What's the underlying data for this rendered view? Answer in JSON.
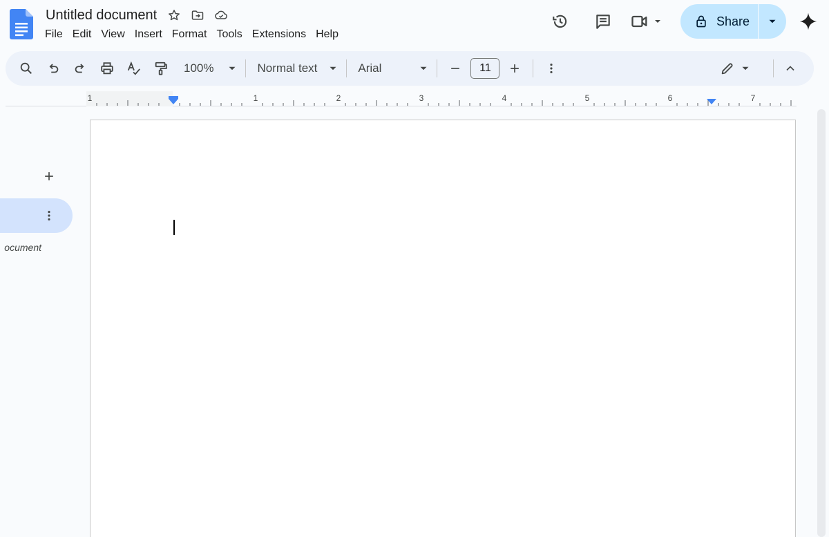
{
  "header": {
    "title": "Untitled document",
    "menu": [
      "File",
      "Edit",
      "View",
      "Insert",
      "Format",
      "Tools",
      "Extensions",
      "Help"
    ],
    "share_label": "Share",
    "icons": [
      "docs-logo-icon",
      "star-icon",
      "move-folder-icon",
      "cloud-saved-icon",
      "version-history-icon",
      "comments-icon",
      "meet-icon",
      "lock-icon",
      "gemini-icon"
    ]
  },
  "toolbar": {
    "zoom": "100%",
    "style": "Normal text",
    "font": "Arial",
    "font_size": "11"
  },
  "ruler": {
    "labels": [
      "1",
      "1",
      "2",
      "3",
      "4",
      "5",
      "6",
      "7"
    ]
  },
  "sidebar": {
    "item_label": "ocument"
  },
  "colors": {
    "accent": "#1a73e8",
    "share_bg": "#c2e7ff",
    "toolbar_bg": "#edf2fa",
    "page_bg": "#f9fbfd",
    "side_selected": "#d3e3fd"
  }
}
